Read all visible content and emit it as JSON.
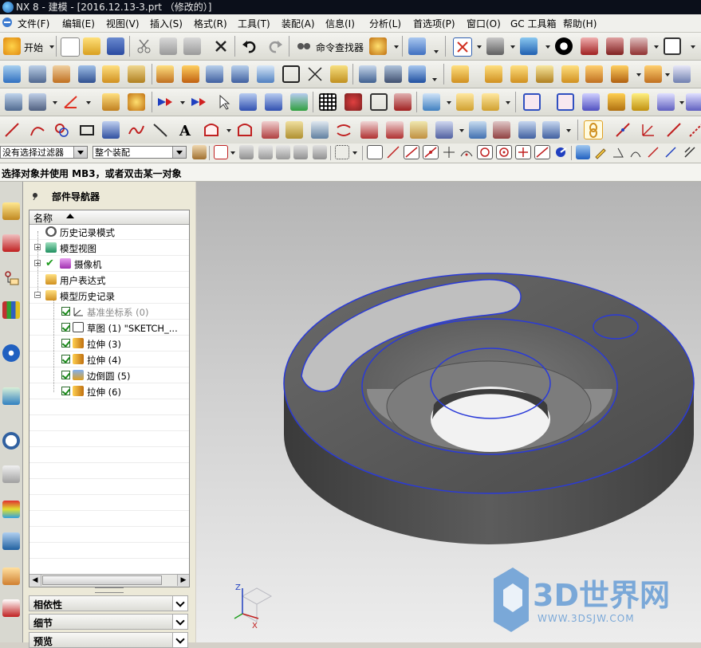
{
  "window": {
    "title": "NX 8 - 建模 - [2016.12.13-3.prt （修改的）]"
  },
  "menu": [
    "文件(F)",
    "编辑(E)",
    "视图(V)",
    "插入(S)",
    "格式(R)",
    "工具(T)",
    "装配(A)",
    "信息(I)",
    "分析(L)",
    "首选项(P)",
    "窗口(O)",
    "GC 工具箱",
    "帮助(H)"
  ],
  "toolbar": {
    "start_label": "开始",
    "command_finder_label": "命令查找器"
  },
  "selection": {
    "filter_value": "没有选择过滤器",
    "scope_value": "整个装配"
  },
  "status": {
    "prompt": "选择对象并使用 MB3，或者双击某一对象"
  },
  "navigator": {
    "title": "部件导航器",
    "column_header": "名称",
    "items": [
      {
        "label": "历史记录模式",
        "icon": "clock-icon"
      },
      {
        "label": "模型视图",
        "icon": "model-views-icon"
      },
      {
        "label": "摄像机",
        "icon": "camera-icon"
      },
      {
        "label": "用户表达式",
        "icon": "folder-icon"
      },
      {
        "label": "模型历史记录",
        "icon": "folder-icon"
      },
      {
        "label": "基准坐标系 (0)",
        "icon": "datum-csys-icon"
      },
      {
        "label": "草图 (1) \"SKETCH_...",
        "icon": "sketch-icon"
      },
      {
        "label": "拉伸 (3)",
        "icon": "extrude-icon"
      },
      {
        "label": "拉伸 (4)",
        "icon": "extrude-icon"
      },
      {
        "label": "边倒圆 (5)",
        "icon": "edge-blend-icon"
      },
      {
        "label": "拉伸 (6)",
        "icon": "extrude-icon"
      }
    ],
    "panels": [
      "相依性",
      "细节",
      "预览"
    ]
  },
  "watermark": {
    "logo_text": "3D世界网",
    "url": "WWW.3DSJW.COM"
  },
  "triad": {
    "z": "Z",
    "x": "X"
  }
}
